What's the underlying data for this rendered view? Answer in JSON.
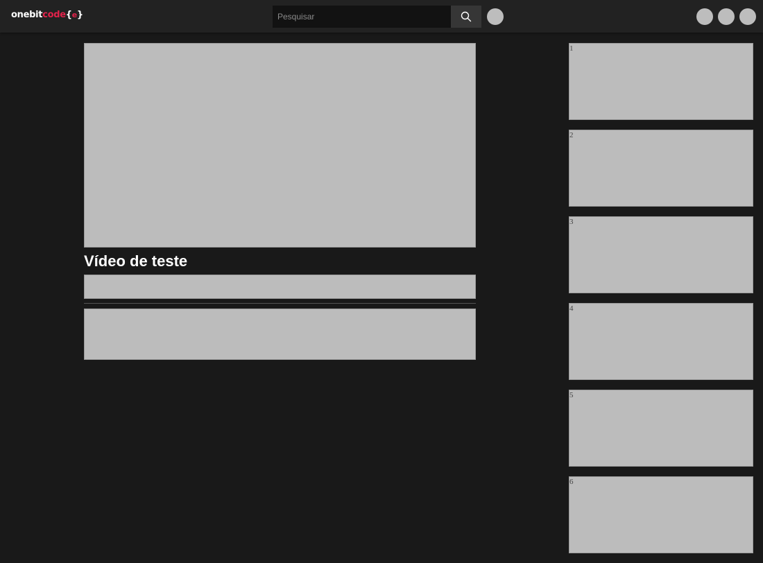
{
  "header": {
    "logo": {
      "part1": "onebit",
      "part2": "code",
      "part3": "{",
      "part4": "e",
      "part5": "}"
    },
    "search": {
      "placeholder": "Pesquisar"
    }
  },
  "video": {
    "title": "Vídeo de teste"
  },
  "recommendations": [
    "1",
    "2",
    "3",
    "4",
    "5",
    "6"
  ],
  "colors": {
    "background": "#191919",
    "topbar": "#222222",
    "accent": "#e3224b",
    "placeholder_block": "#bcbcbc"
  }
}
